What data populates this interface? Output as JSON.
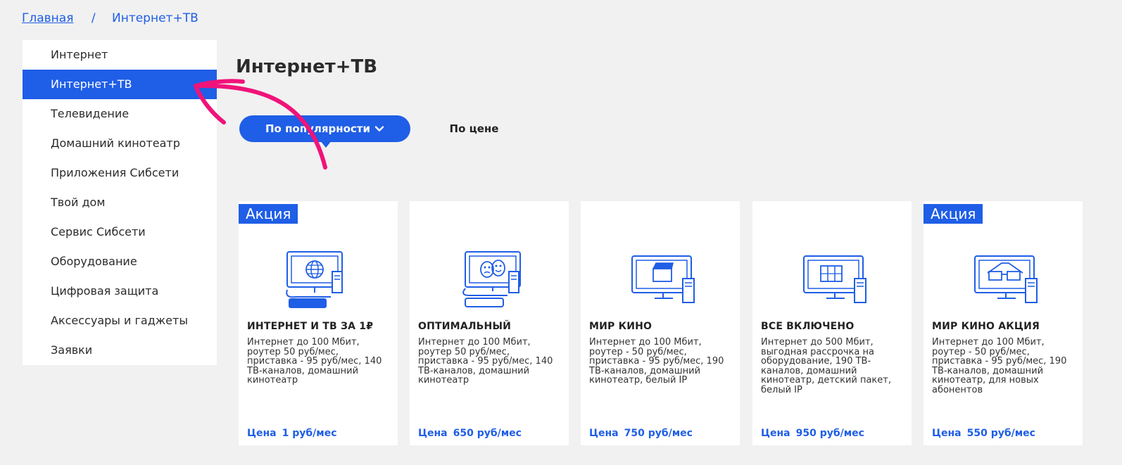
{
  "breadcrumb": {
    "home": "Главная",
    "separator": "/",
    "current": "Интернет+ТВ"
  },
  "sidebar": {
    "items": [
      {
        "label": "Интернет",
        "active": false
      },
      {
        "label": "Интернет+ТВ",
        "active": true
      },
      {
        "label": "Телевидение",
        "active": false
      },
      {
        "label": "Домашний кинотеатр",
        "active": false
      },
      {
        "label": "Приложения Сибсети",
        "active": false
      },
      {
        "label": "Твой дом",
        "active": false
      },
      {
        "label": "Сервис Сибсети",
        "active": false
      },
      {
        "label": "Оборудование",
        "active": false
      },
      {
        "label": "Цифровая защита",
        "active": false
      },
      {
        "label": "Аксессуары и гаджеты",
        "active": false
      },
      {
        "label": "Заявки",
        "active": false
      }
    ]
  },
  "main": {
    "title": "Интернет+ТВ",
    "sort": {
      "active_label": "По популярности",
      "price_label": "По цене"
    }
  },
  "colors": {
    "accent": "#1f5ee6",
    "annotation_arrow": "#f0137a",
    "background": "#f1f1f1"
  },
  "cards": [
    {
      "promo": "Акция",
      "title": "ИНТЕРНЕТ И ТВ ЗА 1₽",
      "desc": "Интернет до 100 Мбит, роутер 50 руб/мес, приставка - 95 руб/мес, 140 ТВ-каналов, домашний кинотеатр",
      "price_label": "Цена",
      "price": "1 руб/мес",
      "icon": "globe-tv-icon"
    },
    {
      "promo": "",
      "title": "ОПТИМАЛЬНЫЙ",
      "desc": "Интернет до 100 Мбит, роутер 50 руб/мес, приставка - 95 руб/мес, 140 ТВ-каналов, домашний кинотеатр",
      "price_label": "Цена",
      "price": "650 руб/мес",
      "icon": "theater-masks-tv-icon"
    },
    {
      "promo": "",
      "title": "МИР КИНО",
      "desc": "Интернет до 100 Мбит, роутер - 50 руб/мес, приставка - 95 руб/мес, 190 ТВ-каналов, домашний кинотеатр, белый IP",
      "price_label": "Цена",
      "price": "750 руб/мес",
      "icon": "clapperboard-tv-icon"
    },
    {
      "promo": "",
      "title": "ВСЕ ВКЛЮЧЕНО",
      "desc": "Интернет до 500 Мбит, выгодная рассрочка на оборудование, 190 ТВ-каналов, домашний кинотеатр, детский пакет, белый IP",
      "price_label": "Цена",
      "price": "950 руб/мес",
      "icon": "film-tv-icon"
    },
    {
      "promo": "Акция",
      "title": "МИР КИНО АКЦИЯ",
      "desc": "Интернет до 100 Мбит, роутер - 50 руб/мес, приставка - 95 руб/мес, 190 ТВ-каналов, домашний кинотеатр, для новых абонентов",
      "price_label": "Цена",
      "price": "550 руб/мес",
      "icon": "3d-glasses-tv-icon"
    }
  ]
}
